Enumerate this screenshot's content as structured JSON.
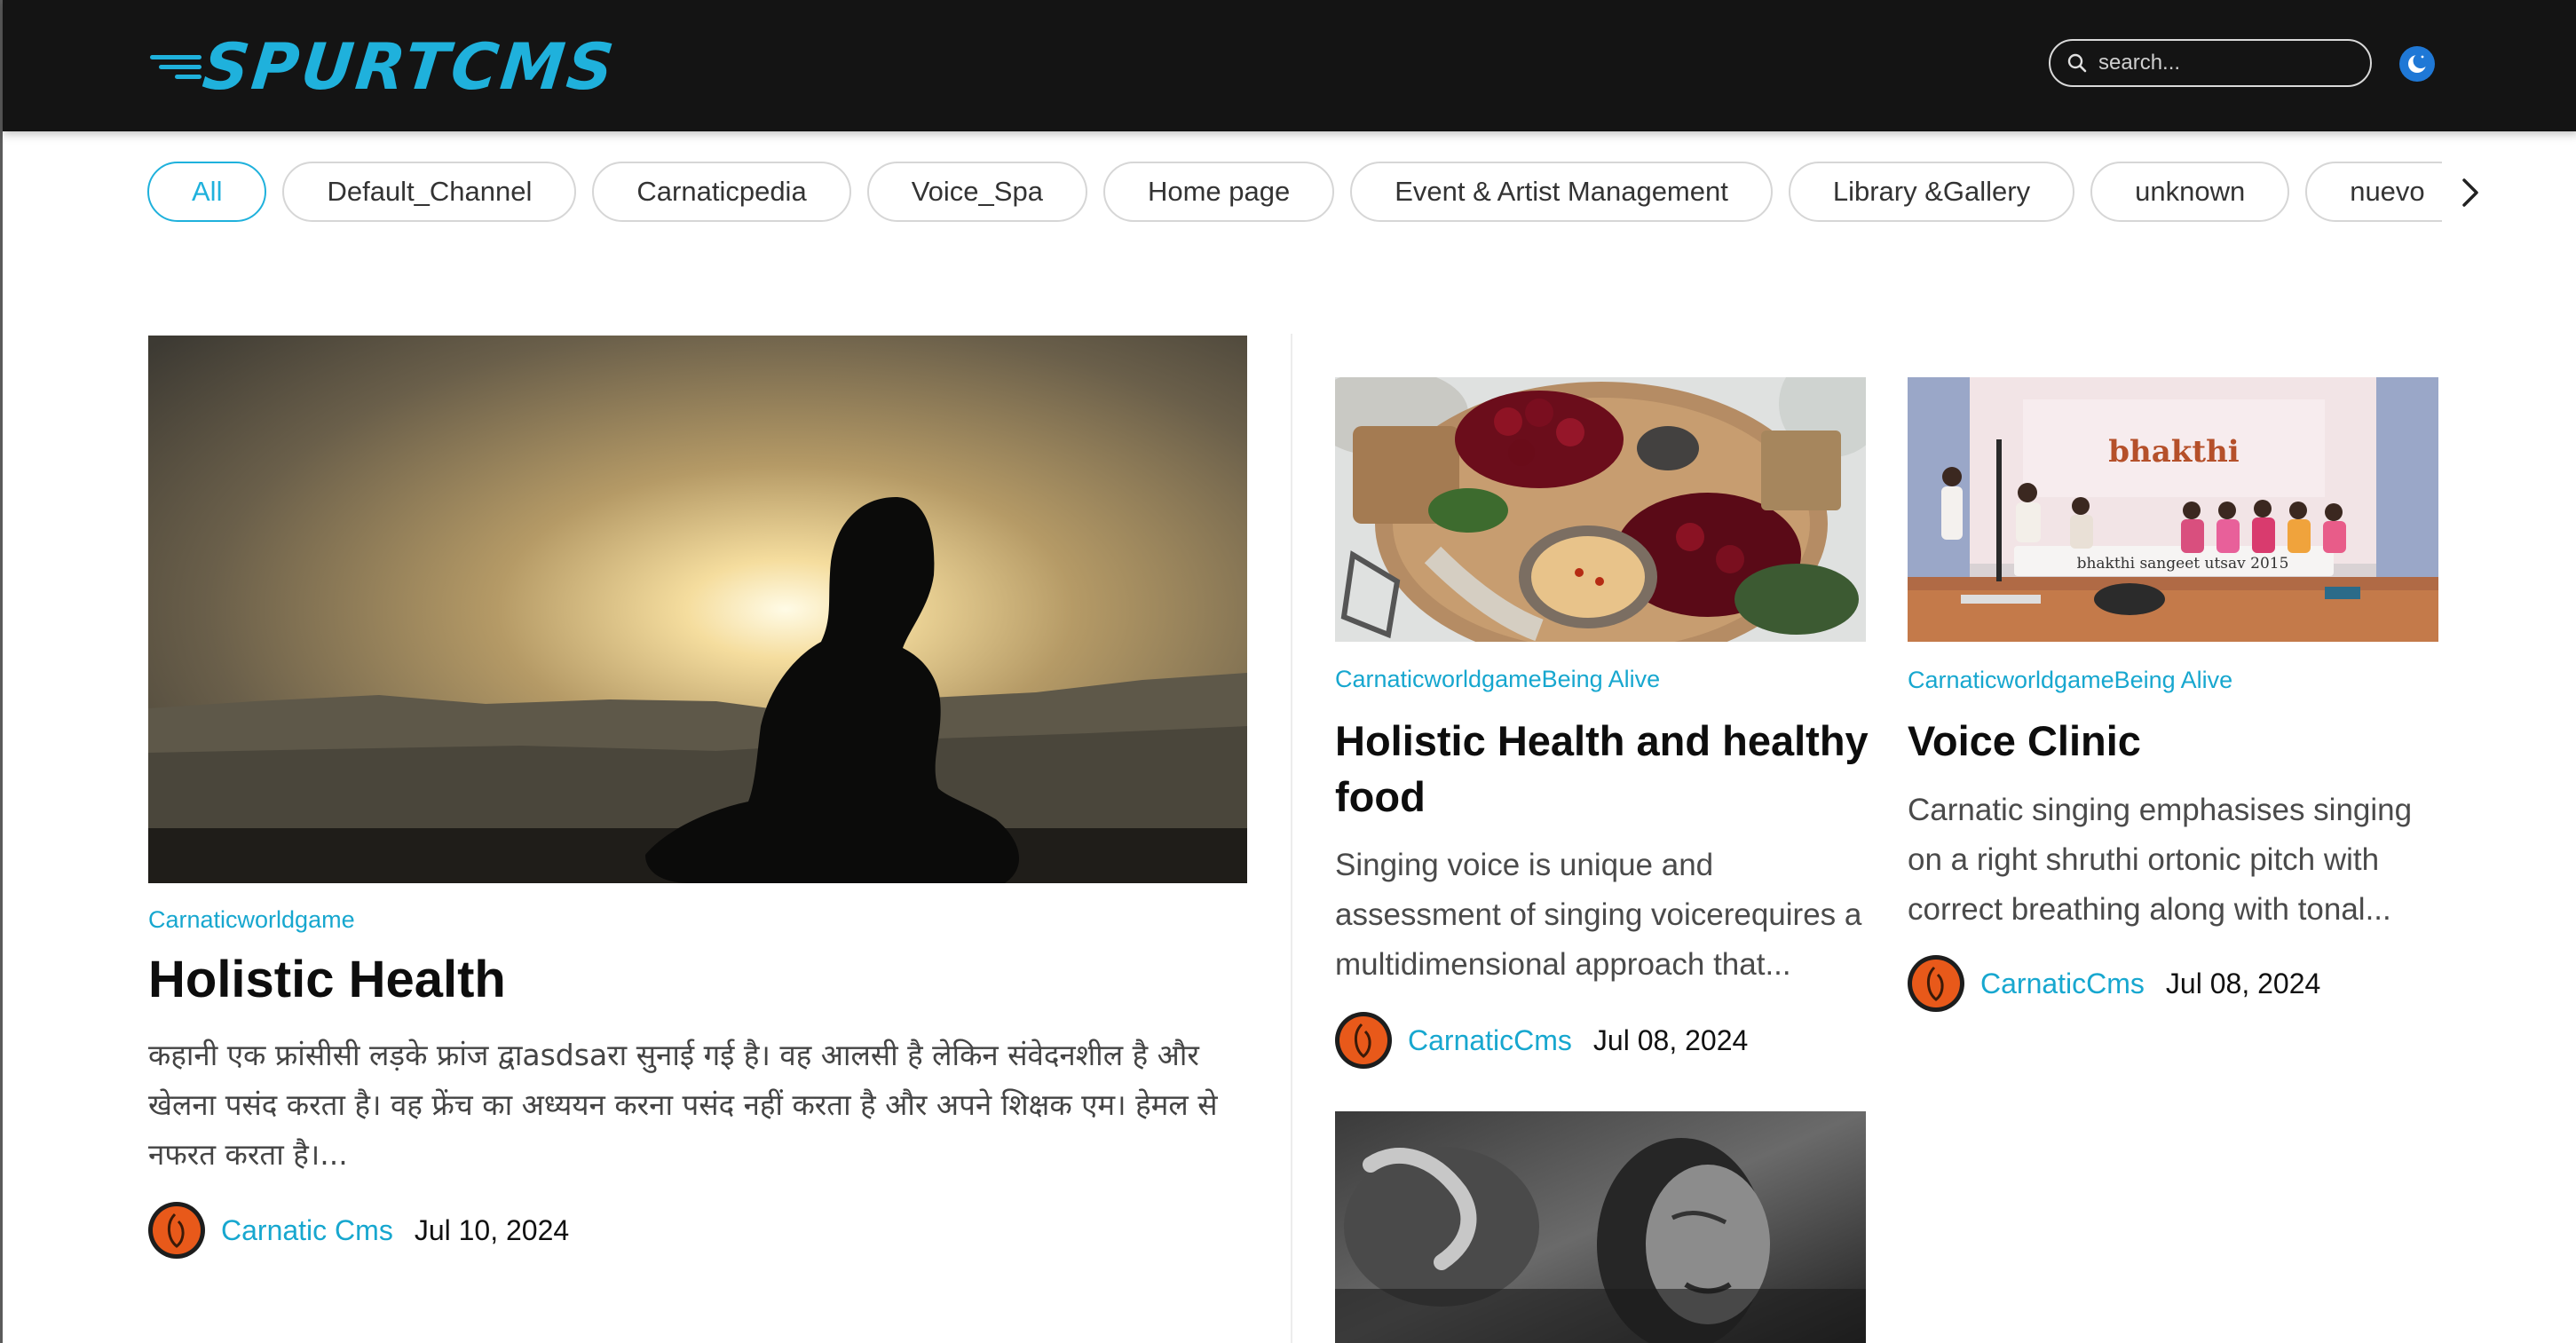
{
  "header": {
    "logo_text": "SPURTCMS",
    "search": {
      "placeholder": "search..."
    },
    "theme_toggle": "moon-icon"
  },
  "channels": {
    "items": [
      {
        "label": "All",
        "active": true
      },
      {
        "label": "Default_Channel",
        "active": false
      },
      {
        "label": "Carnaticpedia",
        "active": false
      },
      {
        "label": "Voice_Spa",
        "active": false
      },
      {
        "label": "Home page",
        "active": false
      },
      {
        "label": "Event & Artist Management",
        "active": false
      },
      {
        "label": "Library &Gallery",
        "active": false
      },
      {
        "label": "unknown",
        "active": false
      },
      {
        "label": "nuevo",
        "active": false
      }
    ],
    "next_icon": "chevron-right-icon"
  },
  "featured": {
    "category": "Carnaticworldgame",
    "title": "Holistic Health",
    "excerpt": "कहानी एक फ्रांसीसी लड़के फ्रांज द्वाasdsaरा सुनाई गई है। वह आलसी है लेकिन संवेदनशील है और खेलना पसंद करता है। वह फ्रेंच का अध्ययन करना पसंद नहीं करता है और अपने शिक्षक एम। हेमल से नफरत करता है।...",
    "author": "Carnatic Cms",
    "date": "Jul 10, 2024"
  },
  "cards": [
    {
      "category": "CarnaticworldgameBeing Alive",
      "title": "Holistic Health and healthy food",
      "excerpt": "Singing voice is unique and assessment of singing voicerequires a multidimensional approach that...",
      "author": "CarnaticCms",
      "date": "Jul 08, 2024"
    },
    {
      "category": "CarnaticworldgameBeing Alive",
      "title": "Voice Clinic",
      "excerpt": "Carnatic singing emphasises singing on a right shruthi ortonic pitch with correct breathing along with tonal...",
      "author": "CarnaticCms",
      "date": "Jul 08, 2024"
    }
  ],
  "event_image": {
    "banner_title": "bhakthi",
    "banner_caption": "bhakthi sangeet utsav 2015"
  },
  "colors": {
    "accent": "#1fb1dc",
    "header_bg": "#141414",
    "avatar_orange": "#e8591a"
  }
}
